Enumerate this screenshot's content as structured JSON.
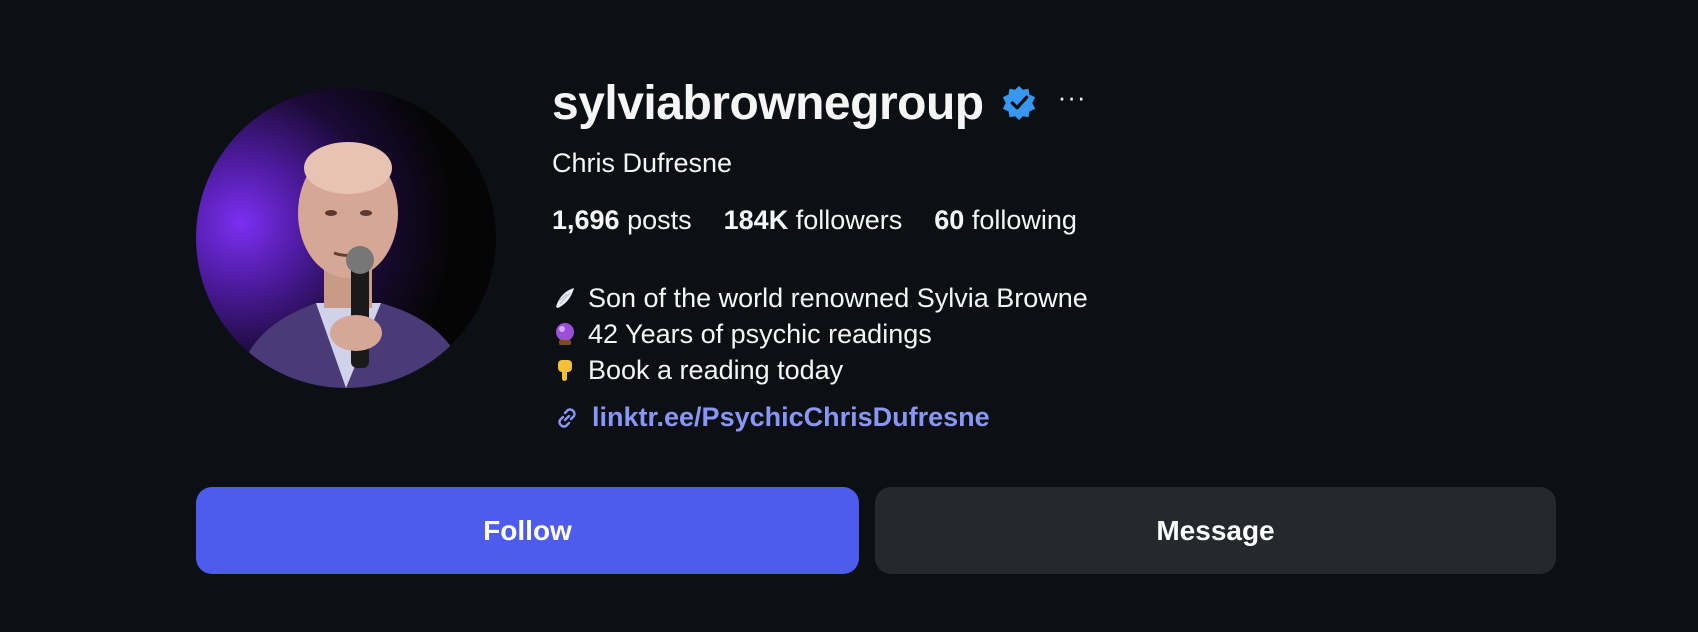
{
  "profile": {
    "username": "sylviabrownegroup",
    "verified_icon": "verified-badge-icon",
    "more_label": "···",
    "full_name": "Chris Dufresne",
    "stats": {
      "posts_count": "1,696",
      "posts_label": "posts",
      "followers_count": "184K",
      "followers_label": "followers",
      "following_count": "60",
      "following_label": "following"
    },
    "bio": [
      {
        "icon": "angel-wing-icon",
        "text": "Son of the world renowned Sylvia Browne"
      },
      {
        "icon": "crystal-ball-icon",
        "text": "42 Years of psychic readings"
      },
      {
        "icon": "pointing-down-icon",
        "text": "Book a reading today"
      }
    ],
    "link": "linktr.ee/PsychicChrisDufresne"
  },
  "actions": {
    "follow_label": "Follow",
    "message_label": "Message"
  },
  "colors": {
    "background": "#0c1014",
    "follow_button": "#4d5cec",
    "message_button": "#25292e",
    "link": "#8a96f5",
    "verified": "#3897f0"
  }
}
